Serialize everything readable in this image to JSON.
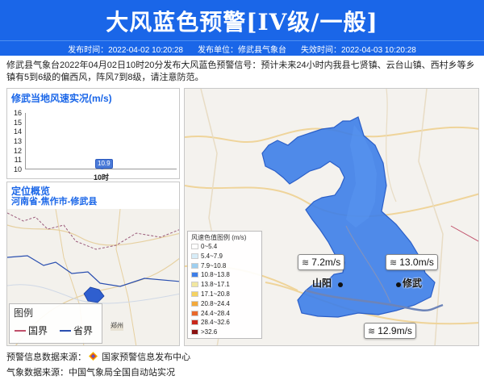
{
  "header": {
    "title": "大风蓝色预警[IV级/一般]",
    "publish_time": "发布时间：2022-04-02 10:20:28",
    "publisher": "发布单位：修武县气象台",
    "expire_time": "失效时间：2022-04-03 10:20:28"
  },
  "description": "修武县气象台2022年04月02日10时20分发布大风蓝色预警信号：预计未来24小时内我县七贤镇、云台山镇、西村乡等乡镇有5到6级的偏西风，阵风7到8级，请注意防范。",
  "wind_panel": {
    "title": "修武当地风速实况(m/s)",
    "y_ticks": [
      "16",
      "15",
      "14",
      "13",
      "12",
      "11",
      "10"
    ],
    "x_tick": "10时",
    "value_label": "10.9"
  },
  "chart_data": {
    "type": "line",
    "title": "修武当地风速实况(m/s)",
    "categories": [
      "10时"
    ],
    "values": [
      10.9
    ],
    "ylim": [
      10,
      16
    ],
    "yticks": [
      10,
      11,
      12,
      13,
      14,
      15,
      16
    ]
  },
  "location_panel": {
    "title": "定位概览",
    "path": "河南省-焦作市-修武县",
    "legend": {
      "title": "图例",
      "items": [
        {
          "label": "国界",
          "color": "#c0506a"
        },
        {
          "label": "省界",
          "color": "#2a4fb0"
        }
      ]
    },
    "city_label": "郑州"
  },
  "main_map": {
    "speed_legend_title": "风速色值图例 (m/s)",
    "speed_legend": [
      {
        "label": "0~5.4",
        "color": "#ffffff"
      },
      {
        "label": "5.4~7.9",
        "color": "#d7ecf8"
      },
      {
        "label": "7.9~10.8",
        "color": "#9ecff0"
      },
      {
        "label": "10.8~13.8",
        "color": "#3d7ee8"
      },
      {
        "label": "13.8~17.1",
        "color": "#f2e7a0"
      },
      {
        "label": "17.1~20.8",
        "color": "#f5d262"
      },
      {
        "label": "20.8~24.4",
        "color": "#f3a93b"
      },
      {
        "label": "24.4~28.4",
        "color": "#e9692b"
      },
      {
        "label": "28.4~32.6",
        "color": "#c9271b"
      },
      {
        "label": ">32.6",
        "color": "#8a1010"
      }
    ],
    "stations": [
      {
        "value": "7.2m/s"
      },
      {
        "value": "13.0m/s"
      },
      {
        "value": "12.9m/s"
      }
    ],
    "towns": [
      "山阳",
      "修武"
    ],
    "wind_glyph": "≋"
  },
  "sources": {
    "warning": "预警信息数据来源：",
    "warning_org": "国家预警信息发布中心",
    "weather": "气象数据来源：中国气象局全国自动站实况"
  },
  "colors": {
    "banner": "#1a66e8",
    "region_fill": "#3d7ee8",
    "accent": "#1a66e8"
  }
}
